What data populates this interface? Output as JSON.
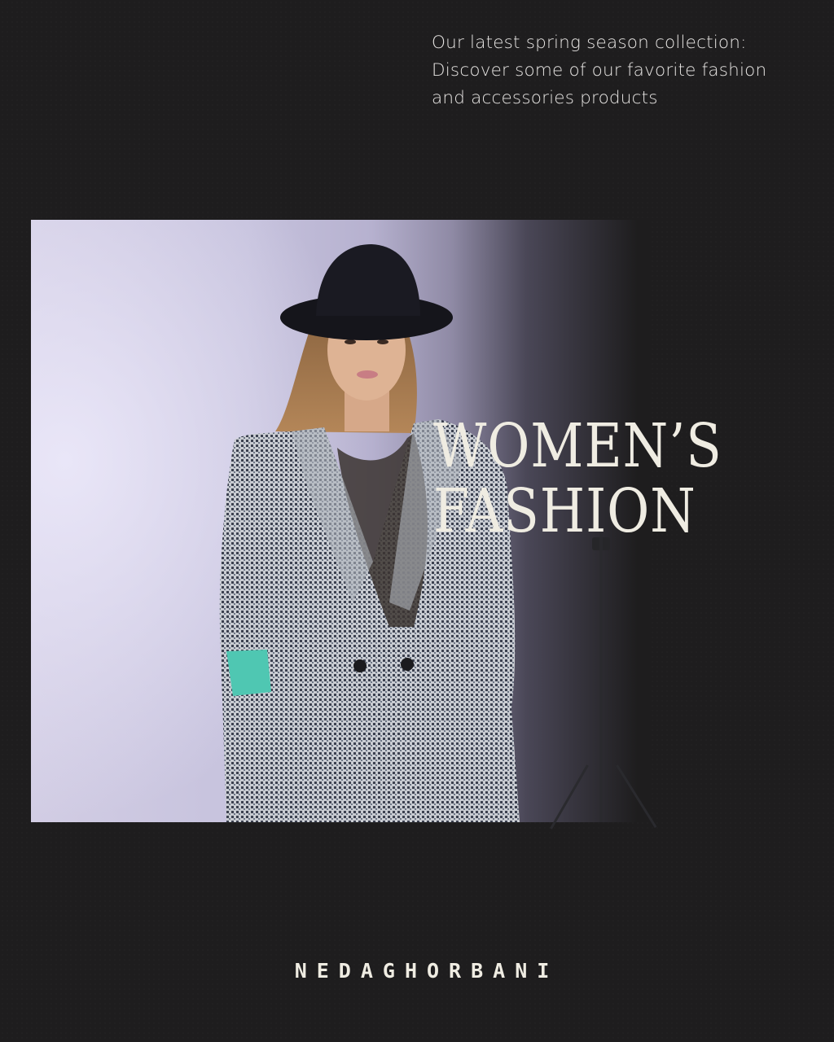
{
  "intro": {
    "line1": "Our latest spring season collection:",
    "line2": "Discover some of our favorite fashion",
    "line3": "and accessories products"
  },
  "headline": {
    "line1": "WOMEN’S",
    "line2": "FASHION"
  },
  "brand": {
    "name": "NEDAGHORBANI"
  },
  "colors": {
    "background": "#1e1d1e",
    "text": "#efece2",
    "backdrop": "#c6c2dd",
    "accent": "#4fc7b2"
  }
}
